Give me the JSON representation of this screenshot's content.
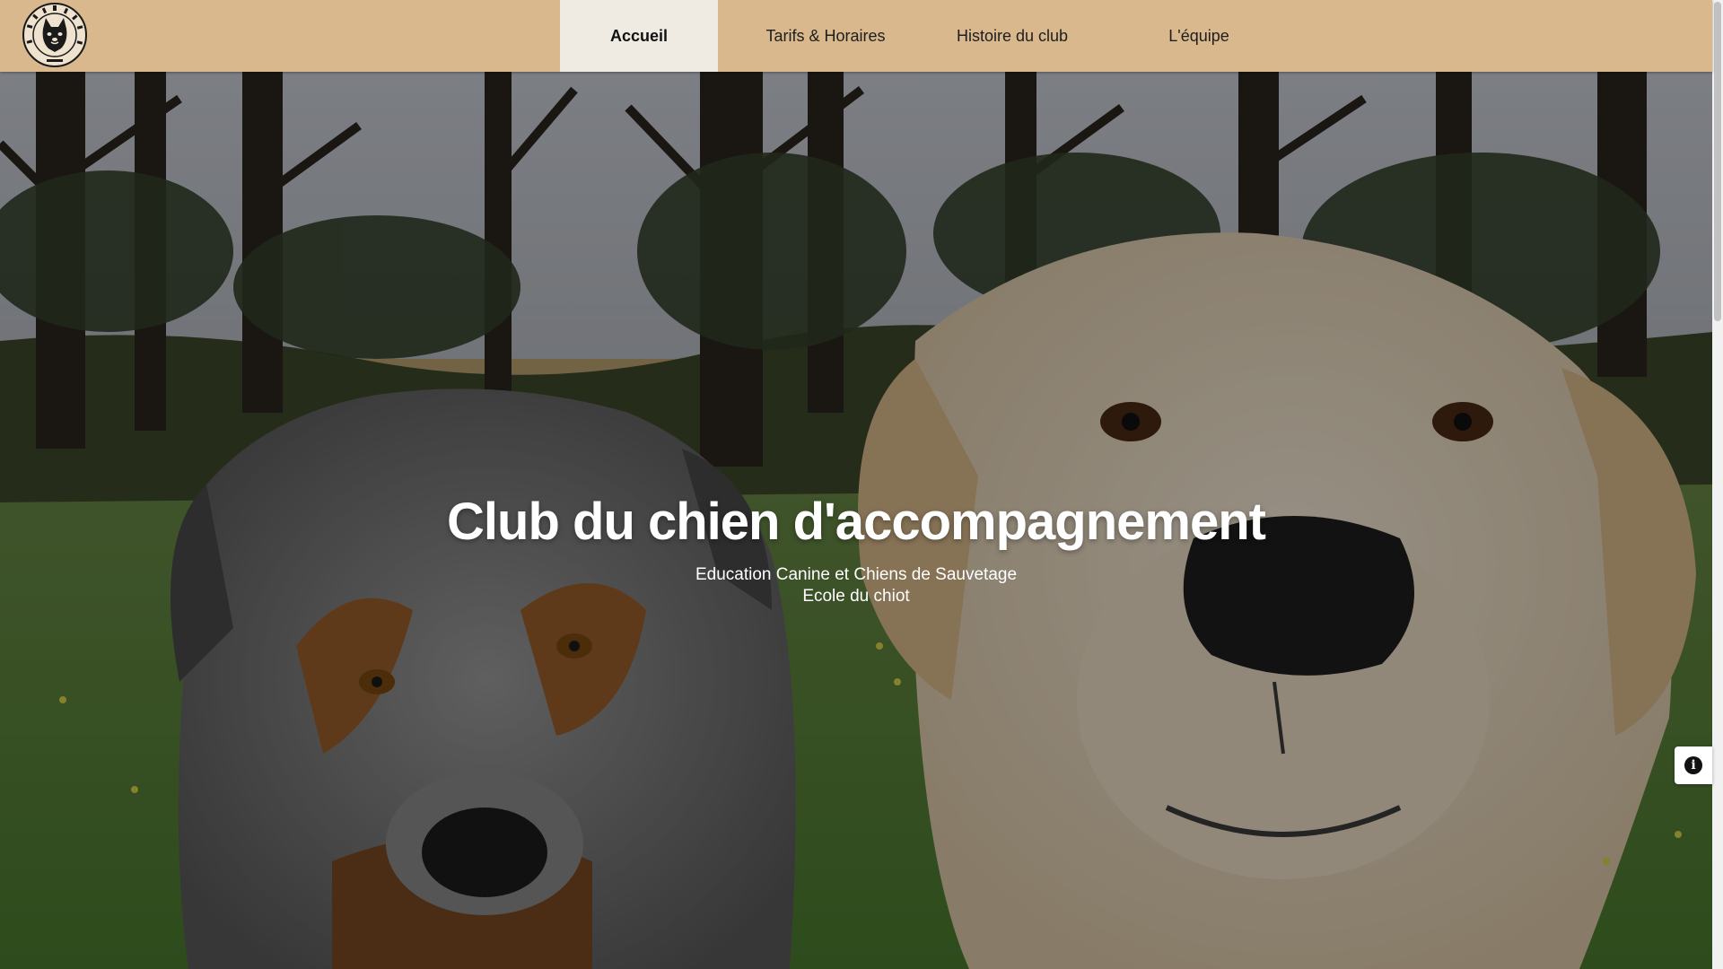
{
  "logo": {
    "name": "club-logo",
    "text": "CLUB DU CHIEN D'ACCOMPAGNEMENT · MILLIEUX"
  },
  "nav": {
    "items": [
      {
        "label": "Accueil",
        "active": true
      },
      {
        "label": "Tarifs & Horaires",
        "active": false
      },
      {
        "label": "Histoire du club",
        "active": false
      },
      {
        "label": "L'équipe",
        "active": false
      }
    ]
  },
  "hero": {
    "title": "Club du chien d'accompagnement",
    "subtitle_line1": "Education Canine et Chiens de Sauvetage",
    "subtitle_line2": "Ecole du chiot"
  },
  "info_button": {
    "icon": "info-icon",
    "glyph": "i"
  },
  "colors": {
    "navbar_bg": "#d8b88c",
    "active_tab_bg": "#efebe2",
    "text": "#1e1e1e"
  }
}
